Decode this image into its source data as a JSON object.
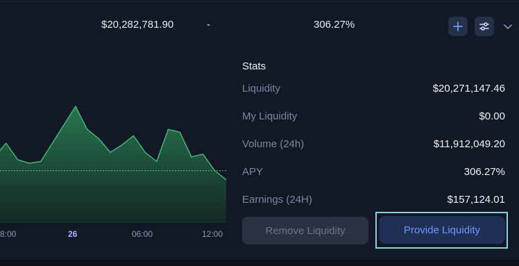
{
  "header": {
    "liquidity": "$20,282,781.90",
    "volume": "-",
    "apy": "306.27%",
    "add_icon": "plus-icon",
    "settings_icon": "sliders-icon",
    "expand_icon": "chevron-down-icon"
  },
  "chart": {
    "x_ticks": [
      "8:00",
      "26",
      "06:00",
      "12:00"
    ]
  },
  "chart_data": {
    "type": "area",
    "series": [
      {
        "values": [
          195,
          210,
          192,
          188,
          190,
          210,
          230,
          250,
          225,
          215,
          200,
          208,
          218,
          200,
          190,
          225,
          222,
          195,
          198,
          180,
          170
        ]
      }
    ],
    "baseline": 180,
    "grid": false,
    "colors": {
      "line": "#3fbf7a",
      "fill": "#1f5a3e",
      "baseline": "#4fd08a"
    }
  },
  "stats": {
    "title": "Stats",
    "rows": [
      {
        "label": "Liquidity",
        "value": "$20,271,147.46"
      },
      {
        "label": "My Liquidity",
        "value": "$0.00"
      },
      {
        "label": "Volume (24h)",
        "value": "$11,912,049.20"
      },
      {
        "label": "APY",
        "value": "306.27%"
      },
      {
        "label": "Earnings (24H)",
        "value": "$157,124.01"
      }
    ]
  },
  "actions": {
    "remove_label": "Remove Liquidity",
    "provide_label": "Provide Liquidity"
  },
  "colors": {
    "background": "#121826",
    "accent": "#6f97ff",
    "focus": "#8fd1db"
  }
}
